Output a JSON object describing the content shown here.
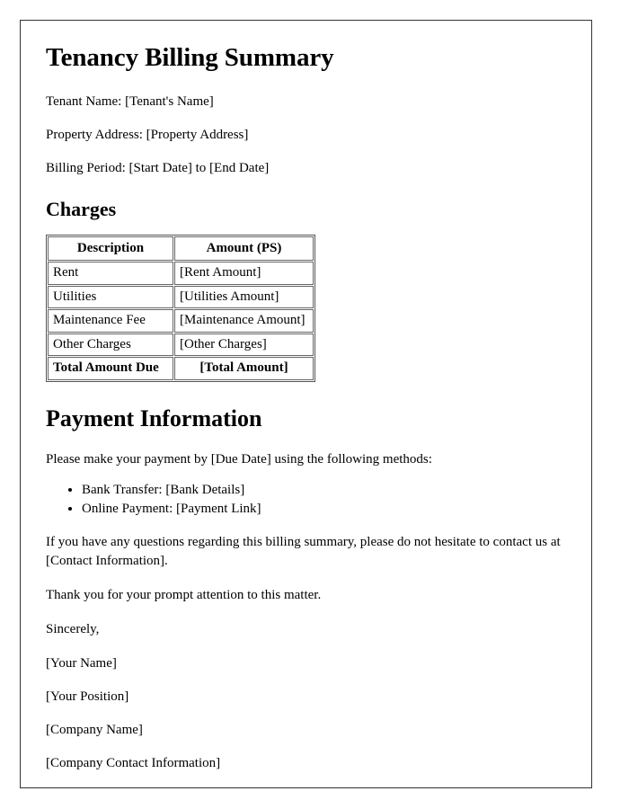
{
  "document": {
    "title": "Tenancy Billing Summary",
    "fields": [
      "Tenant Name: [Tenant's Name]",
      "Property Address: [Property Address]",
      "Billing Period: [Start Date] to [End Date]"
    ],
    "charges_section": {
      "heading": "Charges",
      "table": {
        "columns": [
          "Description",
          "Amount (PS)"
        ],
        "rows": [
          [
            "Rent",
            "[Rent Amount]"
          ],
          [
            "Utilities",
            "[Utilities Amount]"
          ],
          [
            "Maintenance Fee",
            "[Maintenance Amount]"
          ],
          [
            "Other Charges",
            "[Other Charges]"
          ]
        ],
        "total_row": [
          "Total Amount Due",
          "[Total Amount]"
        ]
      }
    },
    "payment_section": {
      "heading": "Payment Information",
      "intro": "Please make your payment by [Due Date] using the following methods:",
      "methods": [
        "Bank Transfer: [Bank Details]",
        "Online Payment: [Payment Link]"
      ],
      "questions": "If you have any questions regarding this billing summary, please do not hesitate to contact us at [Contact Information].",
      "thanks": "Thank you for your prompt attention to this matter."
    },
    "closing": {
      "salutation": "Sincerely,",
      "lines": [
        "[Your Name]",
        "[Your Position]",
        "[Company Name]",
        "[Company Contact Information]"
      ]
    }
  }
}
